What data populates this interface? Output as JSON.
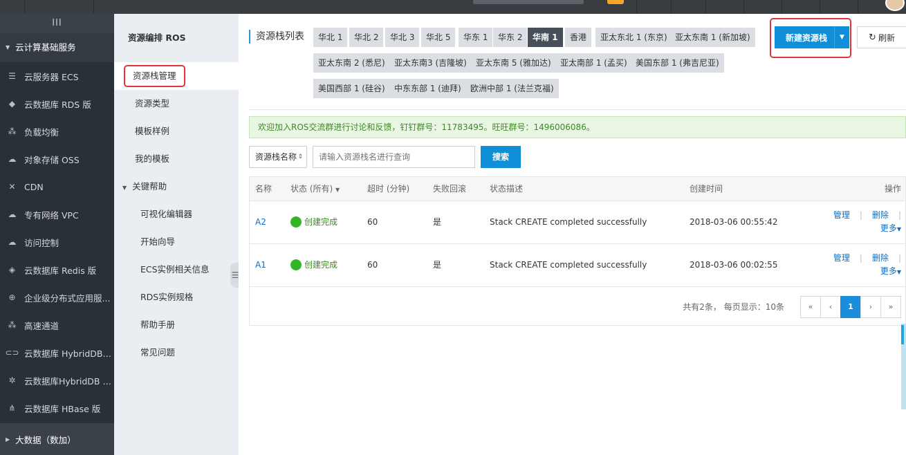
{
  "sidebar": {
    "toggle": "III",
    "group": "云计算基础服务",
    "items": [
      {
        "label": "云服务器 ECS",
        "icon": "server-icon",
        "glyph": "☰"
      },
      {
        "label": "云数据库 RDS 版",
        "icon": "database-icon",
        "glyph": "◆"
      },
      {
        "label": "负载均衡",
        "icon": "load-balancer-icon",
        "glyph": "⁂"
      },
      {
        "label": "对象存储 OSS",
        "icon": "cloud-storage-icon",
        "glyph": "☁"
      },
      {
        "label": "CDN",
        "icon": "cdn-icon",
        "glyph": "✕"
      },
      {
        "label": "专有网络 VPC",
        "icon": "vpc-icon",
        "glyph": "☁"
      },
      {
        "label": "访问控制",
        "icon": "access-control-icon",
        "glyph": "☁"
      },
      {
        "label": "云数据库 Redis 版",
        "icon": "redis-icon",
        "glyph": "◈"
      },
      {
        "label": "企业级分布式应用服...",
        "icon": "distributed-app-icon",
        "glyph": "⊕"
      },
      {
        "label": "高速通道",
        "icon": "express-connect-icon",
        "glyph": "⁂"
      },
      {
        "label": "云数据库 HybridDB f...",
        "icon": "hybriddb-icon",
        "glyph": "⊂⊃"
      },
      {
        "label": "云数据库HybridDB fo...",
        "icon": "hybriddb-alt-icon",
        "glyph": "✲"
      },
      {
        "label": "云数据库 HBase 版",
        "icon": "hbase-icon",
        "glyph": "⋔"
      }
    ],
    "bottom_group": "大数据（数加）"
  },
  "subnav": {
    "title": "资源编排 ROS",
    "items": [
      "资源栈管理",
      "资源类型",
      "模板样例",
      "我的模板"
    ],
    "group": "关键帮助",
    "sub_items": [
      "可视化编辑器",
      "开始向导",
      "ECS实例相关信息",
      "RDS实例规格",
      "帮助手册",
      "常见问题"
    ]
  },
  "main": {
    "title": "资源栈列表",
    "regions": [
      "华北 1",
      "华北 2",
      "华北 3",
      "华北 5",
      "华东 1",
      "华东 2",
      "华南 1",
      "香港",
      "亚太东北 1 (东京)",
      "亚太东南 1 (新加坡)",
      "亚太东南 2 (悉尼)",
      "亚太东南3 (吉隆坡)",
      "亚太东南 5 (雅加达)",
      "亚太南部 1 (孟买)",
      "美国东部 1 (弗吉尼亚)",
      "美国西部 1 (硅谷)",
      "中东东部 1 (迪拜)",
      "欧洲中部 1 (法兰克福)"
    ],
    "active_region": "华南 1",
    "new_button": "新建资源栈",
    "refresh_button": "刷新",
    "notice": "欢迎加入ROS交流群进行讨论和反馈，钉钉群号：11783495。旺旺群号：1496006086。",
    "filter_select": "资源栈名称",
    "search_placeholder": "请输入资源栈名进行查询",
    "search_button": "搜索",
    "columns": [
      "名称",
      "状态 (所有)",
      "超时 (分钟)",
      "失败回滚",
      "状态描述",
      "创建时间",
      "操作"
    ],
    "rows": [
      {
        "name": "A2",
        "status": "创建完成",
        "timeout": "60",
        "rollback": "是",
        "desc": "Stack CREATE completed successfully",
        "created": "2018-03-06 00:55:42"
      },
      {
        "name": "A1",
        "status": "创建完成",
        "timeout": "60",
        "rollback": "是",
        "desc": "Stack CREATE completed successfully",
        "created": "2018-03-06 00:02:55"
      }
    ],
    "ops": {
      "manage": "管理",
      "delete": "删除",
      "more": "更多"
    },
    "pager_info": "共有2条，  每页显示：10条",
    "pager": [
      "«",
      "‹",
      "1",
      "›",
      "»"
    ],
    "current_page": "1"
  },
  "colors": {
    "accent": "#0f8fd8",
    "sidebar_bg": "#293038",
    "highlight_border": "#e0353d",
    "success": "#32b625"
  }
}
